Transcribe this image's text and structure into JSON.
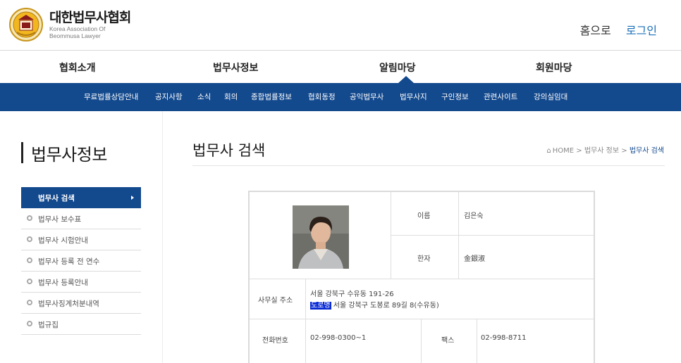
{
  "header": {
    "logo_title": "대한법무사협회",
    "logo_sub_line1": "Korea Association Of",
    "logo_sub_line2": "Beommusa Lawyer",
    "home_label": "홈으로",
    "login_label": "로그인"
  },
  "main_nav": [
    "협회소개",
    "법무사정보",
    "알림마당",
    "회원마당"
  ],
  "sub_nav": [
    "무료법률상담안내",
    "공지사항",
    "소식",
    "회의",
    "종합법률정보",
    "협회동정",
    "공익법무사",
    "법무사지",
    "구인정보",
    "관련사이트",
    "강의실임대"
  ],
  "sidebar": {
    "title": "법무사정보",
    "items": [
      "법무사 검색",
      "법무사 보수표",
      "법무사 시험안내",
      "법무사 등록 전 연수",
      "법무사 등록안내",
      "법무사징계처분내역",
      "법규집"
    ]
  },
  "content": {
    "page_title": "법무사 검색",
    "breadcrumb": {
      "home": "HOME",
      "sep": ">",
      "level1": "법무사 정보",
      "current": "법무사 검색"
    }
  },
  "profile": {
    "name_label": "이름",
    "name_value": "김은숙",
    "hanja_label": "한자",
    "hanja_value": "金銀淑",
    "office_label": "사무실 주소",
    "address_line1": "서울 강북구 수유동 191-26",
    "road_badge": "도로명",
    "address_line2": "서울 강북구 도봉로 89길 8(수유동)",
    "phone_label": "전화번호",
    "phone_value": "02-998-0300~1",
    "fax_label": "팩스",
    "fax_value": "02-998-8711"
  },
  "colors": {
    "navy": "#13498d",
    "highlight": "#0a2ad4",
    "login_link": "#1a6fb9"
  }
}
